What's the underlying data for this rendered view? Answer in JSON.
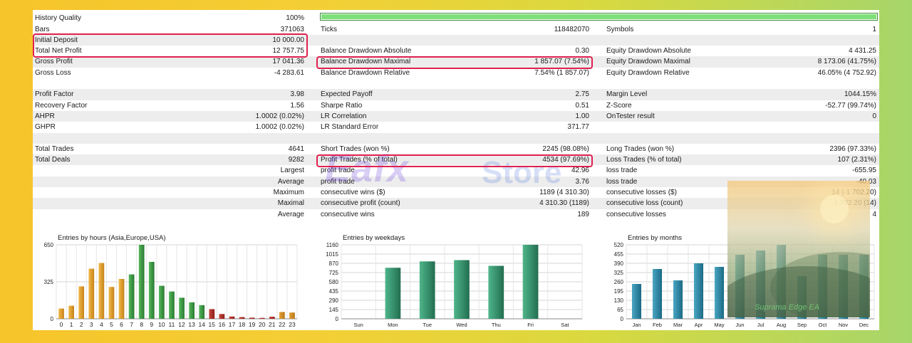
{
  "stats": {
    "history_quality": {
      "label": "History Quality",
      "value": "100%",
      "fraction": 1.0
    },
    "rows": [
      {
        "c1l": "Bars",
        "c1v": "371063",
        "c2l": "Ticks",
        "c2v": "118482070",
        "c3l": "Symbols",
        "c3v": "1"
      },
      {
        "c1l": "Initial Deposit",
        "c1v": "10 000.00",
        "c2l": "",
        "c2v": "",
        "c3l": "",
        "c3v": ""
      },
      {
        "c1l": "Total Net Profit",
        "c1v": "12 757.75",
        "c2l": "Balance Drawdown Absolute",
        "c2v": "0.30",
        "c3l": "Equity Drawdown Absolute",
        "c3v": "4 431.25"
      },
      {
        "c1l": "Gross Profit",
        "c1v": "17 041.36",
        "c2l": "Balance Drawdown Maximal",
        "c2v": "1 857.07 (7.54%)",
        "c3l": "Equity Drawdown Maximal",
        "c3v": "8 173.06 (41.75%)"
      },
      {
        "c1l": "Gross Loss",
        "c1v": "-4 283.61",
        "c2l": "Balance Drawdown Relative",
        "c2v": "7.54% (1 857.07)",
        "c3l": "Equity Drawdown Relative",
        "c3v": "46.05% (4 752.92)"
      },
      {
        "c1l": "",
        "c1v": "",
        "c2l": "",
        "c2v": "",
        "c3l": "",
        "c3v": ""
      },
      {
        "c1l": "Profit Factor",
        "c1v": "3.98",
        "c2l": "Expected Payoff",
        "c2v": "2.75",
        "c3l": "Margin Level",
        "c3v": "1044.15%"
      },
      {
        "c1l": "Recovery Factor",
        "c1v": "1.56",
        "c2l": "Sharpe Ratio",
        "c2v": "0.51",
        "c3l": "Z-Score",
        "c3v": "-52.77 (99.74%)"
      },
      {
        "c1l": "AHPR",
        "c1v": "1.0002 (0.02%)",
        "c2l": "LR Correlation",
        "c2v": "1.00",
        "c3l": "OnTester result",
        "c3v": "0"
      },
      {
        "c1l": "GHPR",
        "c1v": "1.0002 (0.02%)",
        "c2l": "LR Standard Error",
        "c2v": "371.77",
        "c3l": "",
        "c3v": ""
      },
      {
        "c1l": "",
        "c1v": "",
        "c2l": "",
        "c2v": "",
        "c3l": "",
        "c3v": ""
      },
      {
        "c1l": "Total Trades",
        "c1v": "4641",
        "c2l": "Short Trades (won %)",
        "c2v": "2245 (98.08%)",
        "c3l": "Long Trades (won %)",
        "c3v": "2396 (97.33%)"
      },
      {
        "c1l": "Total Deals",
        "c1v": "9282",
        "c2l": "Profit Trades (% of total)",
        "c2v": "4534 (97.69%)",
        "c3l": "Loss Trades (% of total)",
        "c3v": "107 (2.31%)"
      },
      {
        "c1r": "Largest",
        "c2l": "profit trade",
        "c2v": "42.96",
        "c3l": "loss trade",
        "c3v": "-655.95"
      },
      {
        "c1r": "Average",
        "c2l": "profit trade",
        "c2v": "3.76",
        "c3l": "loss trade",
        "c3v": "-40.03"
      },
      {
        "c1r": "Maximum",
        "c2l": "consecutive wins ($)",
        "c2v": "1189 (4 310.30)",
        "c3l": "consecutive losses ($)",
        "c3v": "14 (-1 702.20)"
      },
      {
        "c1r": "Maximal",
        "c2l": "consecutive profit (count)",
        "c2v": "4 310.30 (1189)",
        "c3l": "consecutive loss (count)",
        "c3v": "-1 702.20 (14)"
      },
      {
        "c1r": "Average",
        "c2l": "consecutive wins",
        "c2v": "189",
        "c3l": "consecutive losses",
        "c3v": "4"
      }
    ]
  },
  "watermark": {
    "brand": "Eafx",
    "suffix": "Store"
  },
  "ea_name": "Suprama Edge EA",
  "colors": {
    "highlight": "#e0204f",
    "quality_fill": "#7fe07a",
    "win": "#2e8b3e",
    "loss": "#b0302a"
  },
  "chart_data": [
    {
      "type": "bar",
      "title": "Entries by hours (Asia,Europe,USA)",
      "categories": [
        "0",
        "1",
        "2",
        "3",
        "4",
        "5",
        "6",
        "7",
        "8",
        "9",
        "10",
        "11",
        "12",
        "13",
        "14",
        "15",
        "16",
        "17",
        "18",
        "19",
        "20",
        "21",
        "22",
        "23"
      ],
      "values": [
        90,
        115,
        285,
        440,
        490,
        280,
        350,
        390,
        650,
        500,
        290,
        240,
        185,
        145,
        120,
        85,
        42,
        20,
        15,
        10,
        8,
        18,
        60,
        55
      ],
      "ylim": [
        0,
        650
      ],
      "yticks": [
        "0",
        "325",
        "650"
      ],
      "grid": true
    },
    {
      "type": "bar",
      "title": "Entries by weekdays",
      "categories": [
        "Sun",
        "Mon",
        "Tue",
        "Wed",
        "Thu",
        "Fri",
        "Sat"
      ],
      "values": [
        0,
        800,
        900,
        920,
        830,
        1160,
        0
      ],
      "ylim": [
        0,
        1160
      ],
      "yticks": [
        "0",
        "145",
        "290",
        "435",
        "580",
        "725",
        "870",
        "1015",
        "1160"
      ],
      "grid": true
    },
    {
      "type": "bar",
      "title": "Entries by months",
      "categories": [
        "Jan",
        "Feb",
        "Mar",
        "Apr",
        "May",
        "Jun",
        "Jul",
        "Aug",
        "Sep",
        "Oct",
        "Nov",
        "Dec"
      ],
      "values": [
        245,
        350,
        270,
        390,
        365,
        450,
        480,
        520,
        300,
        450,
        450,
        450
      ],
      "ylim": [
        0,
        520
      ],
      "yticks": [
        "0",
        "65",
        "130",
        "195",
        "260",
        "325",
        "390",
        "455",
        "520"
      ],
      "grid": true
    }
  ]
}
